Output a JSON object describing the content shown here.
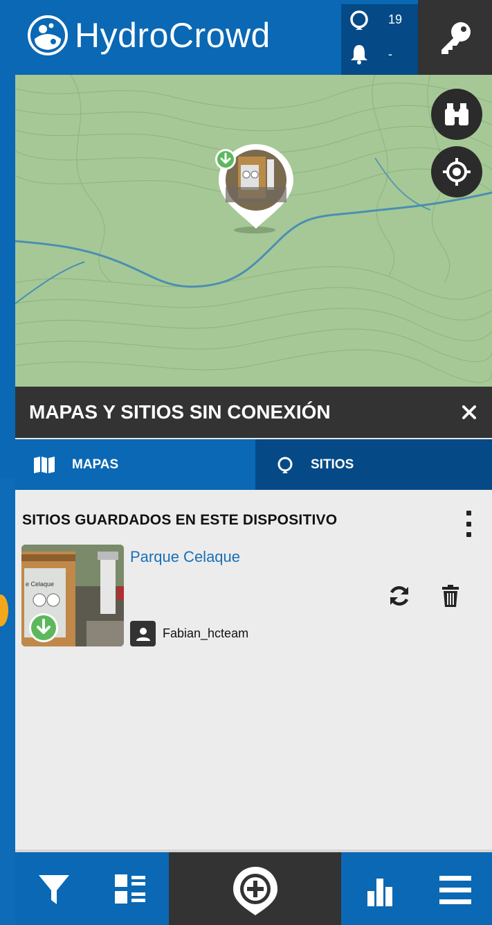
{
  "app": {
    "title": "HydroCrowd"
  },
  "header": {
    "sites_count": "19",
    "notifications_count": "-",
    "icons": {
      "sites": "location-ring-icon",
      "notifications": "bell-icon",
      "login": "key-icon"
    }
  },
  "map": {
    "buttons": {
      "explore": "binoculars-icon",
      "locate": "crosshair-icon"
    },
    "marker": {
      "icon": "download-badge-icon"
    }
  },
  "panel": {
    "title": "MAPAS Y SITIOS SIN CONEXIÓN",
    "tabs": [
      {
        "label": "MAPAS",
        "icon": "map-icon",
        "selected": false
      },
      {
        "label": "SITIOS",
        "icon": "location-ring-icon",
        "selected": true
      }
    ],
    "section_title": "SITIOS GUARDADOS EN ESTE DISPOSITIVO",
    "sites": [
      {
        "name": "Parque Celaque",
        "user": "Fabian_hcteam"
      }
    ]
  },
  "bottom_bar": {
    "icons": [
      "filter-icon",
      "list-view-icon",
      "add-icon",
      "bar-chart-icon",
      "menu-icon"
    ]
  },
  "colors": {
    "primary": "#0a68b4",
    "dark": "#333333",
    "tab_selected": "#054a86",
    "link": "#1a6fb5",
    "map_green": "#a4c694",
    "river": "#4a8fb2",
    "badge_green": "#5cb85c"
  }
}
